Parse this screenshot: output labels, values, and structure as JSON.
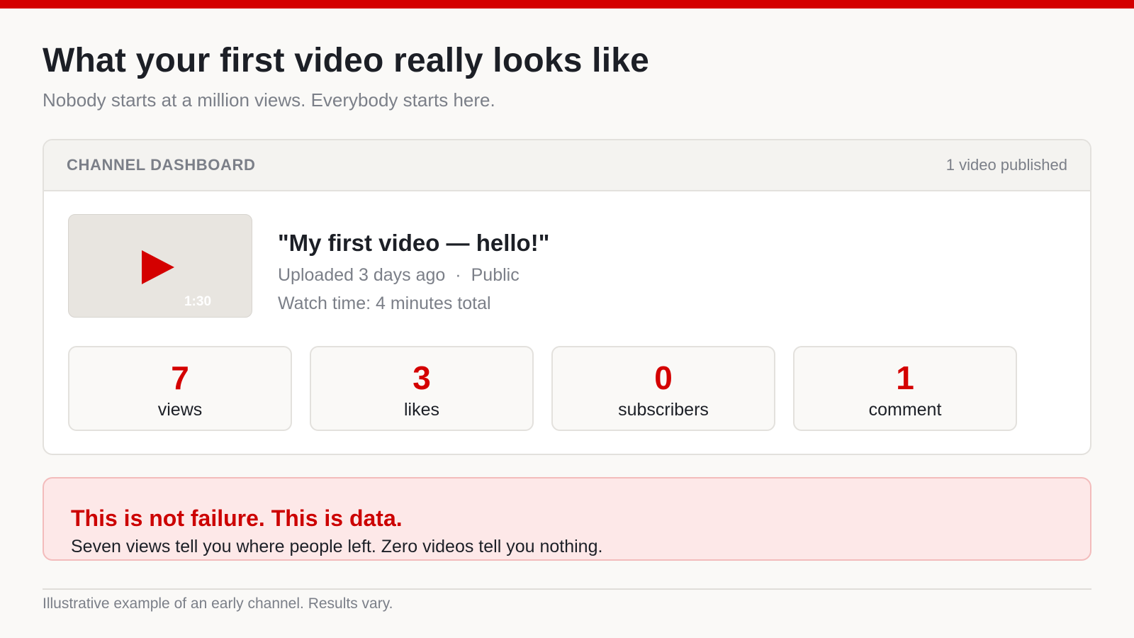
{
  "header": {
    "title": "What your first video really looks like",
    "subtitle": "Nobody starts at a million views. Everybody starts here."
  },
  "dashboard": {
    "label": "CHANNEL DASHBOARD",
    "published_count": "1 video published",
    "video": {
      "title": "\"My first video — hello!\"",
      "uploaded": "Uploaded 3 days ago",
      "separator": "·",
      "visibility": "Public",
      "watch_time": "Watch time: 4 minutes total",
      "duration": "1:30",
      "thumbnail_icon": "play-icon"
    },
    "stats": [
      {
        "value": "7",
        "label": "views"
      },
      {
        "value": "3",
        "label": "likes"
      },
      {
        "value": "0",
        "label": "subscribers"
      },
      {
        "value": "1",
        "label": "comment"
      }
    ]
  },
  "callout": {
    "title": "This is not failure. This is data.",
    "body": "Seven views tell you where people left. Zero videos tell you nothing."
  },
  "footnote": "Illustrative example of an early channel. Results vary.",
  "colors": {
    "accent": "#d40000",
    "callout_background": "#fde8e8",
    "muted_text": "#7b7f88"
  }
}
